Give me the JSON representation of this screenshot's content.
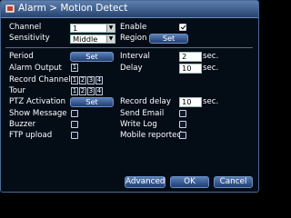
{
  "window": {
    "title": "Alarm > Motion Detect"
  },
  "labels": {
    "channel": "Channel",
    "sensitivity": "Sensitivity",
    "enable": "Enable",
    "region": "Region",
    "period": "Period",
    "interval": "Interval",
    "alarm_output": "Alarm Output",
    "delay": "Delay",
    "record_channel": "Record Channel",
    "tour": "Tour",
    "ptz_activation": "PTZ Activation",
    "record_delay": "Record delay",
    "show_message": "Show Message",
    "send_email": "Send Email",
    "buzzer": "Buzzer",
    "write_log": "Write Log",
    "ftp_upload": "FTP upload",
    "mobile_reported": "Mobile reported"
  },
  "fields": {
    "channel": "1",
    "sensitivity": "Middle",
    "interval": "2",
    "delay": "10",
    "record_delay": "10",
    "sec": "sec."
  },
  "buttons": {
    "set": "Set",
    "advanced": "Advanced",
    "ok": "OK",
    "cancel": "Cancel"
  },
  "alarm_output_channels": [
    "1"
  ],
  "record_channels": [
    "1",
    "2",
    "3",
    "4"
  ],
  "tour_channels": [
    "1",
    "2",
    "3",
    "4"
  ],
  "checks": {
    "enable": true,
    "show_message": false,
    "send_email": false,
    "buzzer": false,
    "write_log": false,
    "ftp_upload": false,
    "mobile_reported": false
  }
}
